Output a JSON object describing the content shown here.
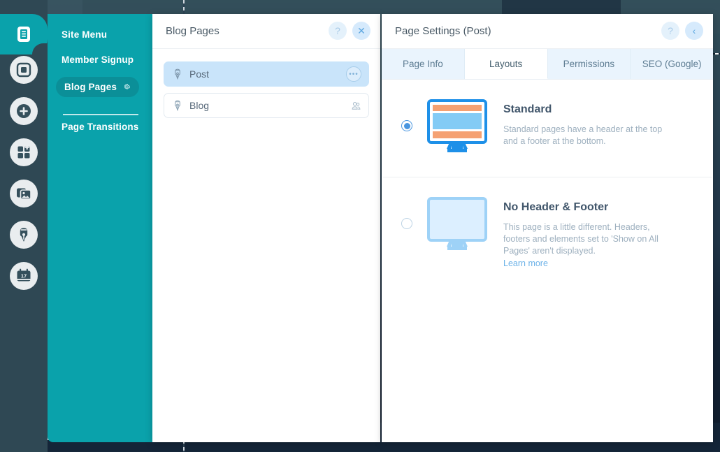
{
  "colors": {
    "teal": "#0aa2ab",
    "teal_dark": "#0b8f98",
    "rail": "#2f4854",
    "accent_blue": "#4a96e0",
    "selected_row": "#c9e4fa",
    "tab_inactive": "#eaf4fd",
    "orange": "#f5a172"
  },
  "rail": {
    "items": [
      {
        "name": "pages-icon",
        "label": "Pages",
        "active": true
      },
      {
        "name": "background-icon",
        "label": "Background",
        "active": false
      },
      {
        "name": "add-icon",
        "label": "Add",
        "active": false
      },
      {
        "name": "add-apps-icon",
        "label": "Add Apps",
        "active": false
      },
      {
        "name": "media-icon",
        "label": "Media",
        "active": false
      },
      {
        "name": "blog-icon",
        "label": "Blog",
        "active": false
      },
      {
        "name": "bookings-icon",
        "label": "Bookings",
        "active": false
      }
    ]
  },
  "site_menu": {
    "items": [
      {
        "label": "Site Menu",
        "selected": false,
        "has_gear": false
      },
      {
        "label": "Member Signup",
        "selected": false,
        "has_gear": false
      },
      {
        "label": "Blog Pages",
        "selected": true,
        "has_gear": true
      },
      {
        "label": "Page Transitions",
        "selected": false,
        "has_gear": false
      }
    ],
    "gear_icon": "gear-icon"
  },
  "mid_panel": {
    "title": "Blog Pages",
    "help_label": "?",
    "close_label": "✕",
    "rows": [
      {
        "label": "Post",
        "selected": true,
        "action": "dots",
        "action_label": "•••",
        "icon": "pen-nib-icon"
      },
      {
        "label": "Blog",
        "selected": false,
        "action": "members",
        "action_label": "",
        "icon": "pen-nib-icon"
      }
    ]
  },
  "right_panel": {
    "title": "Page Settings (Post)",
    "help_label": "?",
    "collapse_label": "‹",
    "tabs": [
      {
        "label": "Page Info",
        "active": false
      },
      {
        "label": "Layouts",
        "active": true
      },
      {
        "label": "Permissions",
        "active": false
      },
      {
        "label": "SEO (Google)",
        "active": false
      }
    ],
    "layouts": [
      {
        "title": "Standard",
        "description": "Standard pages have a header at the top and a footer at the bottom.",
        "selected": true,
        "thumb": "monitor-with-header-footer-icon",
        "link": ""
      },
      {
        "title": "No Header & Footer",
        "description": "This page is a little different. Headers, footers and elements set to 'Show on All Pages' aren't displayed.",
        "selected": false,
        "thumb": "monitor-blank-icon",
        "link": "Learn more"
      }
    ]
  }
}
